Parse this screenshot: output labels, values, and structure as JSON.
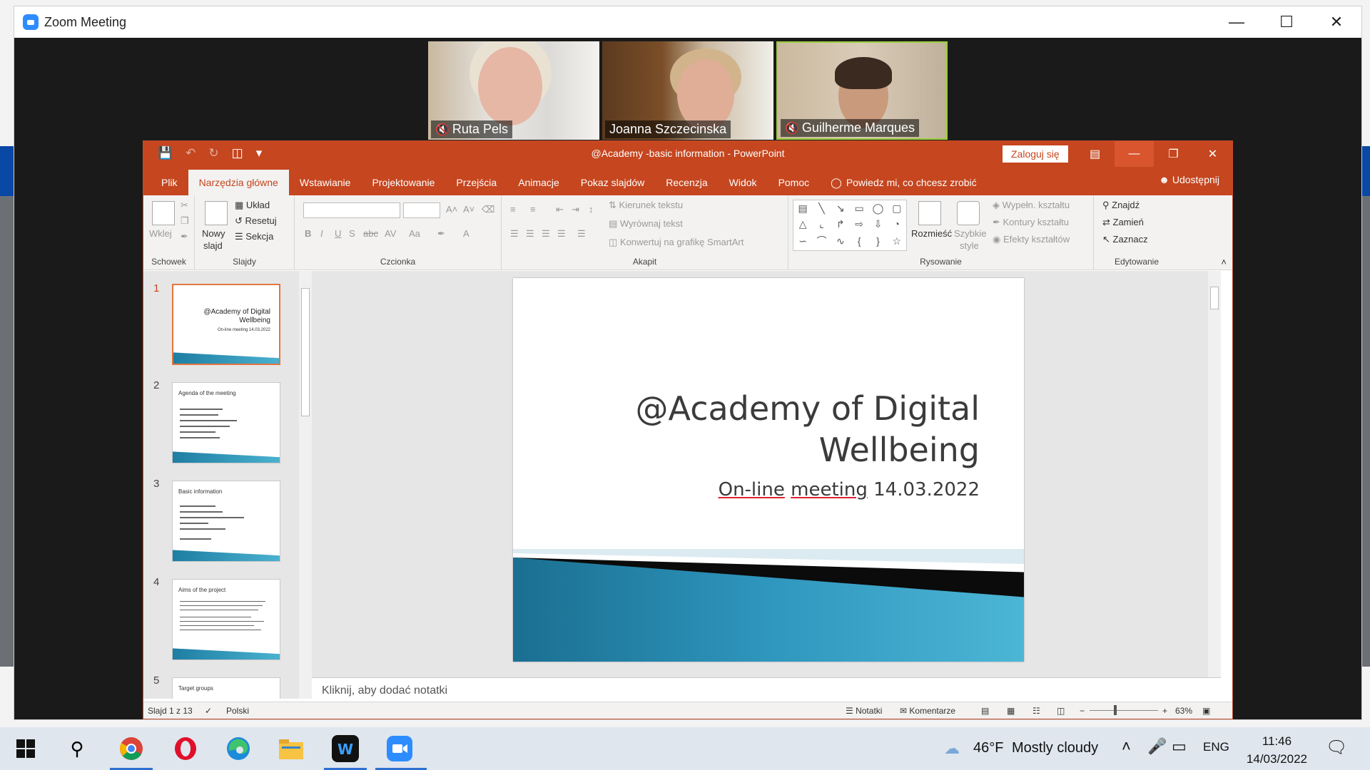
{
  "zoom": {
    "window_title": "Zoom Meeting",
    "participants": [
      {
        "name": "Ruta Pels",
        "muted": true
      },
      {
        "name": "Joanna Szczecinska",
        "muted": false
      },
      {
        "name": "Guilherme Marques",
        "muted": true
      }
    ]
  },
  "powerpoint": {
    "title": "@Academy -basic information  -  PowerPoint",
    "login_label": "Zaloguj się",
    "tabs": [
      "Plik",
      "Narzędzia główne",
      "Wstawianie",
      "Projektowanie",
      "Przejścia",
      "Animacje",
      "Pokaz slajdów",
      "Recenzja",
      "Widok",
      "Pomoc"
    ],
    "tell_me": "Powiedz mi, co chcesz zrobić",
    "share_label": "Udostępnij",
    "ribbon": {
      "clipboard": {
        "label": "Schowek",
        "paste": "Wklej"
      },
      "slides": {
        "label": "Slajdy",
        "new_slide_line1": "Nowy",
        "new_slide_line2": "slajd",
        "layout": "Układ",
        "reset": "Resetuj",
        "section": "Sekcja"
      },
      "font": {
        "label": "Czcionka"
      },
      "paragraph": {
        "label": "Akapit",
        "text_direction": "Kierunek tekstu",
        "align_text": "Wyrównaj tekst",
        "convert_smartart": "Konwertuj na grafikę SmartArt"
      },
      "drawing": {
        "label": "Rysowanie",
        "arrange": "Rozmieść",
        "quick_styles_1": "Szybkie",
        "quick_styles_2": "style",
        "shape_fill": "Wypełn. kształtu",
        "shape_outline": "Kontury kształtu",
        "shape_effects": "Efekty kształtów"
      },
      "editing": {
        "label": "Edytowanie",
        "find": "Znajdź",
        "replace": "Zamień",
        "select": "Zaznacz"
      }
    },
    "thumbnails": [
      {
        "num": "1",
        "title": "@Academy of Digital Wellbeing",
        "sub": "On-line meeting 14.03.2022"
      },
      {
        "num": "2",
        "title": "Agenda of the meeting"
      },
      {
        "num": "3",
        "title": "Basic information"
      },
      {
        "num": "4",
        "title": "Aims of the project"
      },
      {
        "num": "5",
        "title": "Target groups"
      }
    ],
    "slide": {
      "title_line1": "@Academy of Digital",
      "title_line2": "Wellbeing",
      "sub_part1": "On-line",
      "sub_part2": "meeting",
      "sub_part3": "14.03.2022"
    },
    "notes_placeholder": "Kliknij, aby dodać notatki",
    "status": {
      "slide_counter": "Slajd 1 z 13",
      "language": "Polski",
      "notes": "Notatki",
      "comments": "Komentarze",
      "zoom": "63%"
    }
  },
  "taskbar": {
    "weather_temp": "46°F",
    "weather_desc": "Mostly cloudy",
    "language": "ENG",
    "time": "11:46",
    "date": "14/03/2022"
  }
}
